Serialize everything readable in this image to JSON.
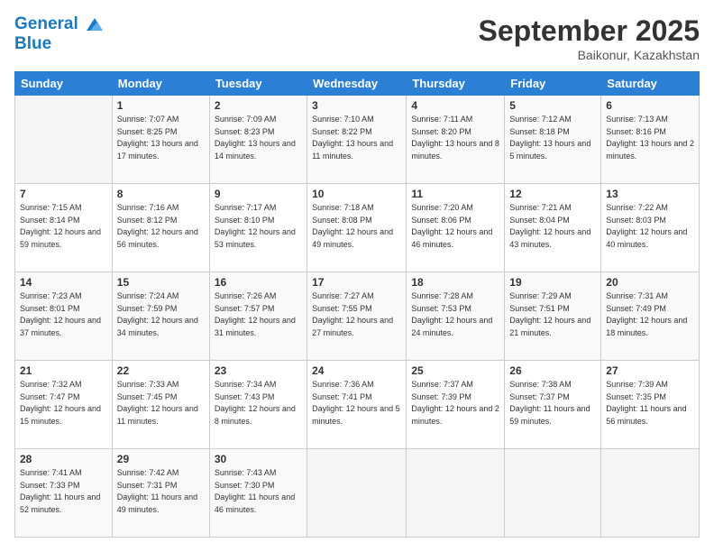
{
  "logo": {
    "line1": "General",
    "line2": "Blue"
  },
  "header": {
    "month": "September 2025",
    "location": "Baikonur, Kazakhstan"
  },
  "days_of_week": [
    "Sunday",
    "Monday",
    "Tuesday",
    "Wednesday",
    "Thursday",
    "Friday",
    "Saturday"
  ],
  "weeks": [
    [
      {
        "day": "",
        "sunrise": "",
        "sunset": "",
        "daylight": ""
      },
      {
        "day": "1",
        "sunrise": "Sunrise: 7:07 AM",
        "sunset": "Sunset: 8:25 PM",
        "daylight": "Daylight: 13 hours and 17 minutes."
      },
      {
        "day": "2",
        "sunrise": "Sunrise: 7:09 AM",
        "sunset": "Sunset: 8:23 PM",
        "daylight": "Daylight: 13 hours and 14 minutes."
      },
      {
        "day": "3",
        "sunrise": "Sunrise: 7:10 AM",
        "sunset": "Sunset: 8:22 PM",
        "daylight": "Daylight: 13 hours and 11 minutes."
      },
      {
        "day": "4",
        "sunrise": "Sunrise: 7:11 AM",
        "sunset": "Sunset: 8:20 PM",
        "daylight": "Daylight: 13 hours and 8 minutes."
      },
      {
        "day": "5",
        "sunrise": "Sunrise: 7:12 AM",
        "sunset": "Sunset: 8:18 PM",
        "daylight": "Daylight: 13 hours and 5 minutes."
      },
      {
        "day": "6",
        "sunrise": "Sunrise: 7:13 AM",
        "sunset": "Sunset: 8:16 PM",
        "daylight": "Daylight: 13 hours and 2 minutes."
      }
    ],
    [
      {
        "day": "7",
        "sunrise": "Sunrise: 7:15 AM",
        "sunset": "Sunset: 8:14 PM",
        "daylight": "Daylight: 12 hours and 59 minutes."
      },
      {
        "day": "8",
        "sunrise": "Sunrise: 7:16 AM",
        "sunset": "Sunset: 8:12 PM",
        "daylight": "Daylight: 12 hours and 56 minutes."
      },
      {
        "day": "9",
        "sunrise": "Sunrise: 7:17 AM",
        "sunset": "Sunset: 8:10 PM",
        "daylight": "Daylight: 12 hours and 53 minutes."
      },
      {
        "day": "10",
        "sunrise": "Sunrise: 7:18 AM",
        "sunset": "Sunset: 8:08 PM",
        "daylight": "Daylight: 12 hours and 49 minutes."
      },
      {
        "day": "11",
        "sunrise": "Sunrise: 7:20 AM",
        "sunset": "Sunset: 8:06 PM",
        "daylight": "Daylight: 12 hours and 46 minutes."
      },
      {
        "day": "12",
        "sunrise": "Sunrise: 7:21 AM",
        "sunset": "Sunset: 8:04 PM",
        "daylight": "Daylight: 12 hours and 43 minutes."
      },
      {
        "day": "13",
        "sunrise": "Sunrise: 7:22 AM",
        "sunset": "Sunset: 8:03 PM",
        "daylight": "Daylight: 12 hours and 40 minutes."
      }
    ],
    [
      {
        "day": "14",
        "sunrise": "Sunrise: 7:23 AM",
        "sunset": "Sunset: 8:01 PM",
        "daylight": "Daylight: 12 hours and 37 minutes."
      },
      {
        "day": "15",
        "sunrise": "Sunrise: 7:24 AM",
        "sunset": "Sunset: 7:59 PM",
        "daylight": "Daylight: 12 hours and 34 minutes."
      },
      {
        "day": "16",
        "sunrise": "Sunrise: 7:26 AM",
        "sunset": "Sunset: 7:57 PM",
        "daylight": "Daylight: 12 hours and 31 minutes."
      },
      {
        "day": "17",
        "sunrise": "Sunrise: 7:27 AM",
        "sunset": "Sunset: 7:55 PM",
        "daylight": "Daylight: 12 hours and 27 minutes."
      },
      {
        "day": "18",
        "sunrise": "Sunrise: 7:28 AM",
        "sunset": "Sunset: 7:53 PM",
        "daylight": "Daylight: 12 hours and 24 minutes."
      },
      {
        "day": "19",
        "sunrise": "Sunrise: 7:29 AM",
        "sunset": "Sunset: 7:51 PM",
        "daylight": "Daylight: 12 hours and 21 minutes."
      },
      {
        "day": "20",
        "sunrise": "Sunrise: 7:31 AM",
        "sunset": "Sunset: 7:49 PM",
        "daylight": "Daylight: 12 hours and 18 minutes."
      }
    ],
    [
      {
        "day": "21",
        "sunrise": "Sunrise: 7:32 AM",
        "sunset": "Sunset: 7:47 PM",
        "daylight": "Daylight: 12 hours and 15 minutes."
      },
      {
        "day": "22",
        "sunrise": "Sunrise: 7:33 AM",
        "sunset": "Sunset: 7:45 PM",
        "daylight": "Daylight: 12 hours and 11 minutes."
      },
      {
        "day": "23",
        "sunrise": "Sunrise: 7:34 AM",
        "sunset": "Sunset: 7:43 PM",
        "daylight": "Daylight: 12 hours and 8 minutes."
      },
      {
        "day": "24",
        "sunrise": "Sunrise: 7:36 AM",
        "sunset": "Sunset: 7:41 PM",
        "daylight": "Daylight: 12 hours and 5 minutes."
      },
      {
        "day": "25",
        "sunrise": "Sunrise: 7:37 AM",
        "sunset": "Sunset: 7:39 PM",
        "daylight": "Daylight: 12 hours and 2 minutes."
      },
      {
        "day": "26",
        "sunrise": "Sunrise: 7:38 AM",
        "sunset": "Sunset: 7:37 PM",
        "daylight": "Daylight: 11 hours and 59 minutes."
      },
      {
        "day": "27",
        "sunrise": "Sunrise: 7:39 AM",
        "sunset": "Sunset: 7:35 PM",
        "daylight": "Daylight: 11 hours and 56 minutes."
      }
    ],
    [
      {
        "day": "28",
        "sunrise": "Sunrise: 7:41 AM",
        "sunset": "Sunset: 7:33 PM",
        "daylight": "Daylight: 11 hours and 52 minutes."
      },
      {
        "day": "29",
        "sunrise": "Sunrise: 7:42 AM",
        "sunset": "Sunset: 7:31 PM",
        "daylight": "Daylight: 11 hours and 49 minutes."
      },
      {
        "day": "30",
        "sunrise": "Sunrise: 7:43 AM",
        "sunset": "Sunset: 7:30 PM",
        "daylight": "Daylight: 11 hours and 46 minutes."
      },
      {
        "day": "",
        "sunrise": "",
        "sunset": "",
        "daylight": ""
      },
      {
        "day": "",
        "sunrise": "",
        "sunset": "",
        "daylight": ""
      },
      {
        "day": "",
        "sunrise": "",
        "sunset": "",
        "daylight": ""
      },
      {
        "day": "",
        "sunrise": "",
        "sunset": "",
        "daylight": ""
      }
    ]
  ]
}
